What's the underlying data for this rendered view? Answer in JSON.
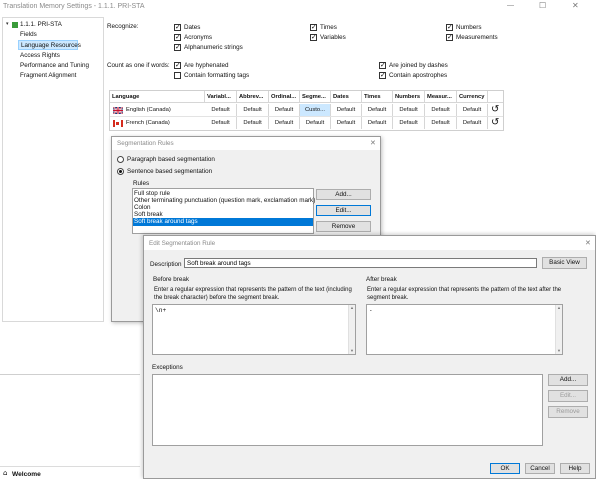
{
  "window": {
    "title": "Translation Memory Settings - 1.1.1. PRI-STA",
    "controls": [
      "—",
      "☐",
      "✕"
    ]
  },
  "tree": {
    "root": "1.1.1. PRI-STA",
    "items": [
      "Fields",
      "Language Resources",
      "Access Rights",
      "Performance and Tuning",
      "Fragment Alignment"
    ]
  },
  "recognize": {
    "label": "Recognize:",
    "options": [
      "Dates",
      "Acronyms",
      "Alphanumeric strings",
      "Times",
      "Variables",
      "Numbers",
      "Measurements"
    ]
  },
  "count_words": {
    "label": "Count as one if words:",
    "options": [
      "Are hyphenated",
      "Contain formatting tags",
      "Are joined by dashes",
      "Contain apostrophes"
    ]
  },
  "lang_table": {
    "headers": [
      "Language",
      "Variabl...",
      "Abbrev...",
      "Ordinal...",
      "Segme...",
      "Dates",
      "Times",
      "Numbers",
      "Measur...",
      "Currency"
    ],
    "rows": [
      {
        "lang": "English (Canada)",
        "values": [
          "Default",
          "Default",
          "Default",
          "Custo...",
          "Default",
          "Default",
          "Default",
          "Default",
          "Default"
        ]
      },
      {
        "lang": "French (Canada)",
        "values": [
          "Default",
          "Default",
          "Default",
          "Default",
          "Default",
          "Default",
          "Default",
          "Default",
          "Default"
        ]
      }
    ],
    "reset_glyph": "↺"
  },
  "seg_rules": {
    "title": "Segmentation Rules",
    "close": "✕",
    "option_paragraph": "Paragraph based segmentation",
    "option_sentence": "Sentence based segmentation",
    "rules_label": "Rules",
    "rules": [
      "Full stop rule",
      "Other terminating punctuation (question mark, exclamation mark)",
      "Colon",
      "Soft break",
      "Soft break around tags"
    ],
    "add": "Add...",
    "edit": "Edit...",
    "remove": "Remove"
  },
  "edit_rule": {
    "title": "Edit Segmentation Rule",
    "close": "✕",
    "description_label": "Description",
    "description_value": "Soft break around tags",
    "basic_view": "Basic View",
    "before_label": "Before break",
    "before_help": "Enter a regular expression that represents the pattern of the text (including the break character) before the segment break.",
    "before_value": "\\n+",
    "after_label": "After break",
    "after_help": "Enter a regular expression that represents the pattern of the text after the segment break.",
    "after_value": ".",
    "exceptions_label": "Exceptions",
    "add": "Add...",
    "edit": "Edit...",
    "remove": "Remove",
    "ok": "OK",
    "cancel": "Cancel",
    "help": "Help"
  },
  "taskpane": {
    "welcome": "Welcome"
  },
  "colors": {
    "selection": "#0078d7",
    "highlight_cell": "#cce8ff",
    "button_face": "#e1e1e1",
    "flag_red": "#d52b1e",
    "flag_blue": "#012169"
  }
}
